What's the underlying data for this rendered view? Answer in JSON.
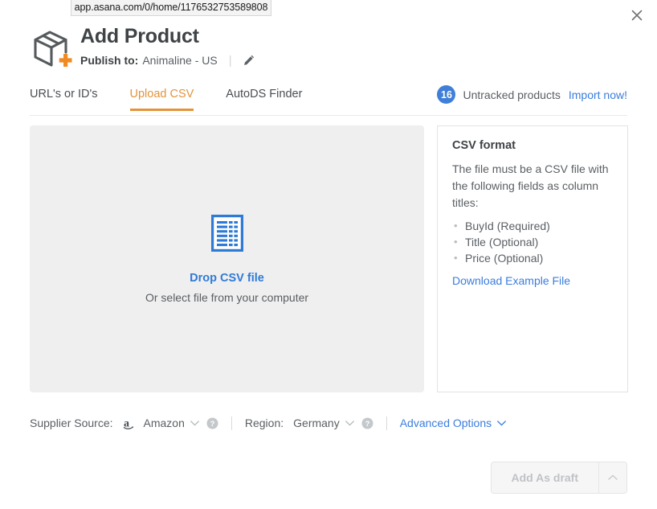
{
  "browser": {
    "status_url": "app.asana.com/0/home/1176532753589808"
  },
  "window": {
    "close_label": "×"
  },
  "header": {
    "title": "Add Product",
    "publish_label": "Publish to:",
    "publish_value": "Animaline - US",
    "edit_icon": "pencil-icon",
    "app_icon": "package-plus-icon"
  },
  "tabs": [
    {
      "label": "URL's or ID's",
      "active": false
    },
    {
      "label": "Upload CSV",
      "active": true
    },
    {
      "label": "AutoDS Finder",
      "active": false
    }
  ],
  "untracked": {
    "count": "16",
    "label": "Untracked products",
    "link": "Import now!"
  },
  "dropzone": {
    "icon": "csv-file-icon",
    "title": "Drop CSV file",
    "subtitle": "Or select file from your computer"
  },
  "csv_panel": {
    "heading": "CSV format",
    "description": "The file must be a CSV file with the following fields as column titles:",
    "fields": [
      "BuyId (Required)",
      "Title (Optional)",
      "Price (Optional)"
    ],
    "download_link": "Download Example File"
  },
  "options": {
    "supplier_label": "Supplier Source:",
    "supplier_value": "Amazon",
    "supplier_icon": "amazon-logo-icon",
    "supplier_help": "help-circle-icon",
    "region_label": "Region:",
    "region_value": "Germany",
    "region_help": "help-circle-icon",
    "advanced_label": "Advanced Options"
  },
  "submit": {
    "label": "Add As draft",
    "caret_icon": "chevron-up-icon"
  },
  "colors": {
    "accent_orange": "#e2943c",
    "link_blue": "#3b7ddd",
    "badge_blue": "#3f7fd8",
    "dropzone_grey": "#efefef",
    "text_grey": "#5a5f63"
  }
}
